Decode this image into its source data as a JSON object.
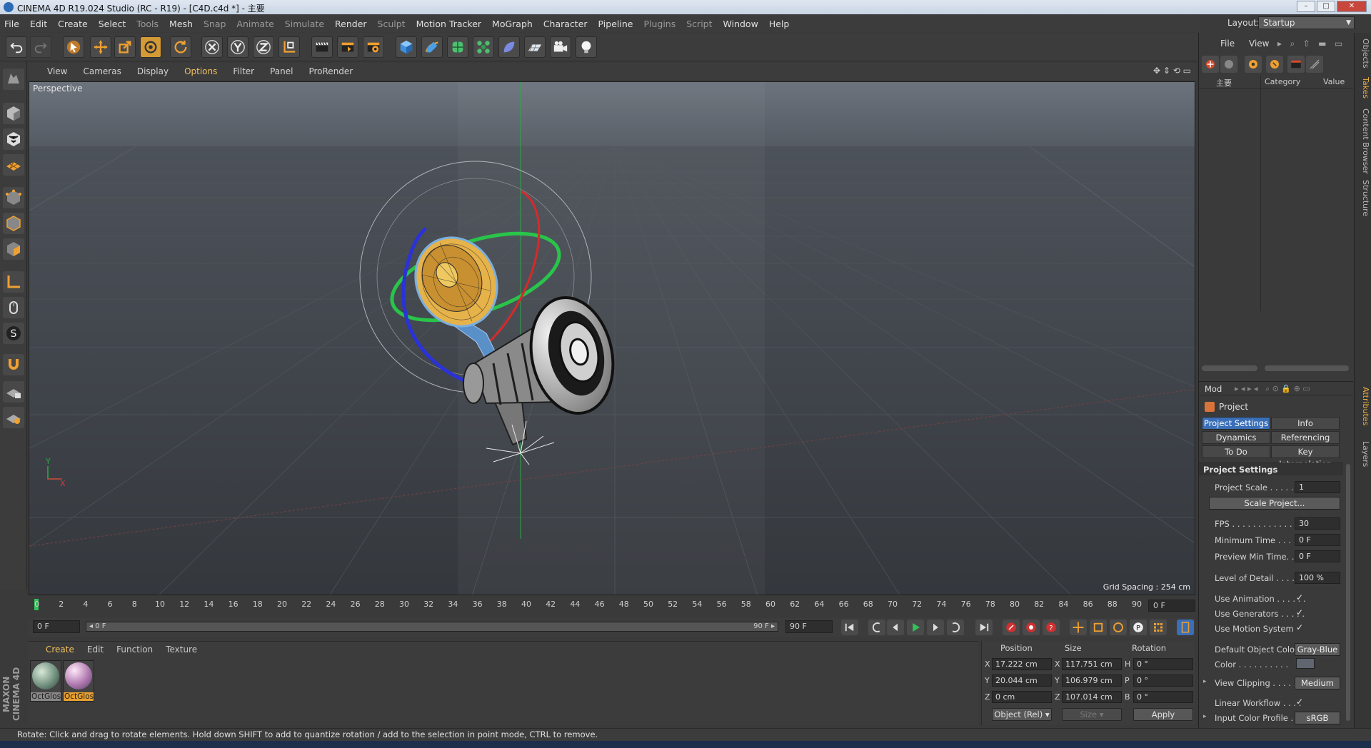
{
  "window": {
    "title": "CINEMA 4D R19.024 Studio (RC - R19) - [C4D.c4d *] - 主要"
  },
  "menu": [
    "File",
    "Edit",
    "Create",
    "Select",
    "Tools",
    "Mesh",
    "Snap",
    "Animate",
    "Simulate",
    "Render",
    "Sculpt",
    "Motion Tracker",
    "MoGraph",
    "Character",
    "Pipeline",
    "Plugins",
    "Script",
    "Window",
    "Help"
  ],
  "layout": {
    "label": "Layout:",
    "value": "Startup"
  },
  "viewport": {
    "menu": [
      "View",
      "Cameras",
      "Display",
      "Options",
      "Filter",
      "Panel",
      "ProRender"
    ],
    "label": "Perspective",
    "grid_spacing": "Grid Spacing : 254 cm",
    "axis_x": "X",
    "axis_y": "Y"
  },
  "timeline": {
    "ticks": [
      "0",
      "2",
      "4",
      "6",
      "8",
      "10",
      "12",
      "14",
      "16",
      "18",
      "20",
      "22",
      "24",
      "26",
      "28",
      "30",
      "32",
      "34",
      "36",
      "38",
      "40",
      "42",
      "44",
      "46",
      "48",
      "50",
      "52",
      "54",
      "56",
      "58",
      "60",
      "62",
      "64",
      "66",
      "68",
      "70",
      "72",
      "74",
      "76",
      "78",
      "80",
      "82",
      "84",
      "86",
      "88",
      "90"
    ],
    "end_field": "0 F",
    "current": "0 F",
    "range_start": "◂ 0 F",
    "range_end": "90 F ▸",
    "max": "90 F"
  },
  "materials": {
    "menu": [
      "Create",
      "Edit",
      "Function",
      "Texture"
    ],
    "items": [
      {
        "label": "OctGlos",
        "color": "#6a8a78"
      },
      {
        "label": "OctGlos",
        "color": "#b07ab0"
      }
    ]
  },
  "brand": "MAXON CINEMA 4D",
  "coords": {
    "headers": [
      "Position",
      "Size",
      "Rotation"
    ],
    "rows": [
      {
        "axis": "X",
        "pos": "17.222 cm",
        "saxis": "X",
        "size": "117.751 cm",
        "raxis": "H",
        "rot": "0 °"
      },
      {
        "axis": "Y",
        "pos": "20.044 cm",
        "saxis": "Y",
        "size": "106.979 cm",
        "raxis": "P",
        "rot": "0 °"
      },
      {
        "axis": "Z",
        "pos": "0 cm",
        "saxis": "Z",
        "size": "107.014 cm",
        "raxis": "B",
        "rot": "0 °"
      }
    ],
    "mode": "Object (Rel)",
    "size_mode": "Size",
    "apply": "Apply"
  },
  "status": "Rotate: Click and drag to rotate elements. Hold down SHIFT to add to quantize rotation / add to the selection in point mode, CTRL to remove.",
  "objects_panel": {
    "menu": [
      "File",
      "View"
    ],
    "tree_item": "主要",
    "columns": [
      "Category",
      "Value"
    ]
  },
  "attributes": {
    "mode": "Mod",
    "title": "Project",
    "tabs": [
      "Project Settings",
      "Info",
      "Dynamics",
      "Referencing",
      "To Do",
      "Key Interpolation"
    ],
    "section": "Project Settings",
    "props": [
      {
        "label": "Project Scale . . . . . . . .",
        "value": "1"
      },
      {
        "label": "FPS . . . . . . . . . . . . . . .",
        "value": "30"
      },
      {
        "label": "Minimum Time . . . . .",
        "value": "0 F"
      },
      {
        "label": "Preview Min Time. . . .",
        "value": "0 F"
      },
      {
        "label": "Level of Detail . . . . . .",
        "value": "100 %"
      }
    ],
    "scale_button": "Scale Project...",
    "checks": [
      {
        "label": "Use Animation . . . . . .",
        "value": "✓"
      },
      {
        "label": "Use Generators . . . . .",
        "value": "✓"
      },
      {
        "label": "Use Motion System",
        "value": "✓"
      }
    ],
    "default_color_label": "Default Object Color",
    "default_color_value": "Gray-Blue",
    "color_label": "Color . . . . . . . . . .",
    "view_clipping_label": "View Clipping . . . . . .",
    "view_clipping_value": "Medium",
    "linear_workflow_label": "Linear Workflow . . . .",
    "linear_workflow_value": "✓",
    "input_profile_label": "Input Color Profile . . .",
    "input_profile_value": "sRGB"
  },
  "side_tabs": [
    "Objects",
    "Takes",
    "Content Browser",
    "Structure",
    "Attributes",
    "Layers"
  ],
  "icons": [
    "undo-icon",
    "redo-icon",
    "select-arrow-icon",
    "move-icon",
    "scale-icon",
    "rotate-icon",
    "rotate-icon",
    "x-axis-icon",
    "y-axis-icon",
    "z-axis-icon",
    "coordinate-system-icon",
    "render-view-icon",
    "render-icon",
    "render-settings-icon",
    "cube-icon",
    "pen-icon",
    "subdivide-icon",
    "cloner-icon",
    "deformer-icon",
    "floor-icon",
    "camera-icon",
    "light-icon"
  ],
  "colors": {
    "accent": "#d49a36",
    "selected_tab": "#3a6fb8",
    "viewport_bg": "#3e4249"
  }
}
